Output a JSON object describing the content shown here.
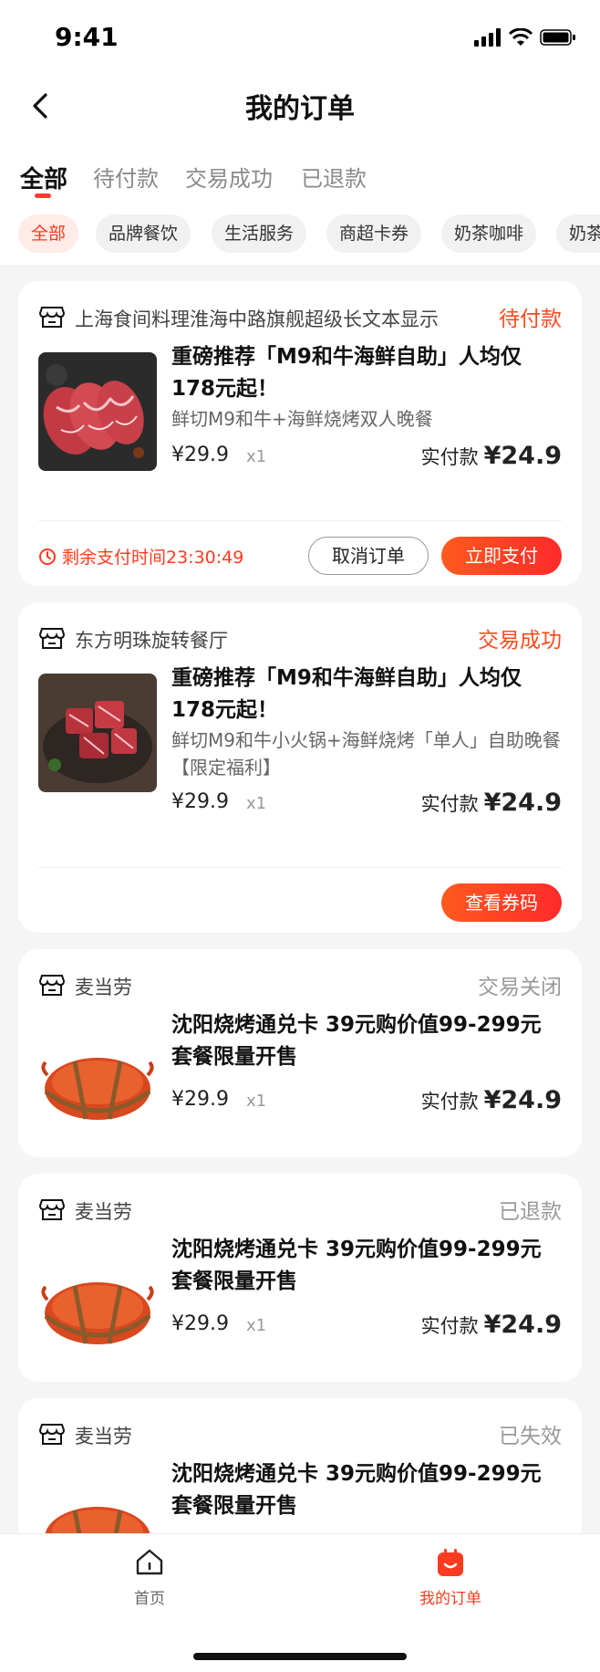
{
  "status_bar": {
    "time": "9:41"
  },
  "header": {
    "title": "我的订单"
  },
  "tabs": [
    {
      "label": "全部",
      "active": true
    },
    {
      "label": "待付款"
    },
    {
      "label": "交易成功"
    },
    {
      "label": "已退款"
    }
  ],
  "chips": [
    {
      "label": "全部",
      "active": true
    },
    {
      "label": "品牌餐饮"
    },
    {
      "label": "生活服务"
    },
    {
      "label": "商超卡券"
    },
    {
      "label": "奶茶咖啡"
    },
    {
      "label": "奶茶"
    }
  ],
  "orders": [
    {
      "store": "上海食间料理淮海中路旗舰超级长文本显示",
      "status": "待付款",
      "title": "重磅推荐「M9和牛海鲜自助」人均仅178元起！",
      "subtitle": "鲜切M9和牛+海鲜烧烤双人晚餐",
      "price": "¥29.9",
      "qty": "x1",
      "paid_label": "实付款",
      "paid_amount": "¥24.9",
      "countdown": "剩余支付时间23:30:49",
      "btn_cancel": "取消订单",
      "btn_pay": "立即支付"
    },
    {
      "store": "东方明珠旋转餐厅",
      "status": "交易成功",
      "title": "重磅推荐「M9和牛海鲜自助」人均仅178元起！",
      "subtitle": "鲜切M9和牛小火锅+海鲜烧烤「单人」自助晚餐【限定福利】",
      "price": "¥29.9",
      "qty": "x1",
      "paid_label": "实付款",
      "paid_amount": "¥24.9",
      "btn_code": "查看券码"
    },
    {
      "store": "麦当劳",
      "status": "交易关闭",
      "title": "沈阳烧烤通兑卡 39元购价值99-299元套餐限量开售",
      "price": "¥29.9",
      "qty": "x1",
      "paid_label": "实付款",
      "paid_amount": "¥24.9"
    },
    {
      "store": "麦当劳",
      "status": "已退款",
      "title": "沈阳烧烤通兑卡 39元购价值99-299元套餐限量开售",
      "price": "¥29.9",
      "qty": "x1",
      "paid_label": "实付款",
      "paid_amount": "¥24.9"
    },
    {
      "store": "麦当劳",
      "status": "已失效",
      "title": "沈阳烧烤通兑卡 39元购价值99-299元套餐限量开售"
    }
  ],
  "bottom_nav": [
    {
      "label": "首页",
      "icon": "home-icon"
    },
    {
      "label": "我的订单",
      "icon": "orders-icon",
      "active": true
    }
  ],
  "colors": {
    "accent": "#ff3b1f",
    "inactive": "#9a9a9a"
  }
}
